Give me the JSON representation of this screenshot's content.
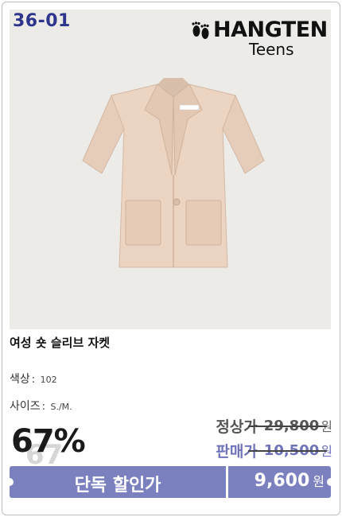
{
  "product": {
    "code": "36-01",
    "brand_name": "HANGTEN",
    "brand_sub": "Teens",
    "title": "여성 숏 슬리브 자켓",
    "color_label": "색상",
    "color_value": "102",
    "size_label": "사이즈",
    "size_value": "S./M.",
    "attr_separator": ":",
    "discount": "67%",
    "discount_shadow": "67",
    "regular_label": "정상가",
    "regular_price": "29,800",
    "sale_label": "판매가",
    "sale_price": "10,500",
    "currency": "원",
    "band_label": "단독 할인가",
    "final_price": "9,600"
  },
  "colors": {
    "code_text": "#2e358c",
    "band": "#7b80bf",
    "sale_text": "#6f73b9",
    "jacket": "#e9d2c0"
  },
  "icons": [
    "footprints-logo-icon",
    "jacket-product-image"
  ]
}
